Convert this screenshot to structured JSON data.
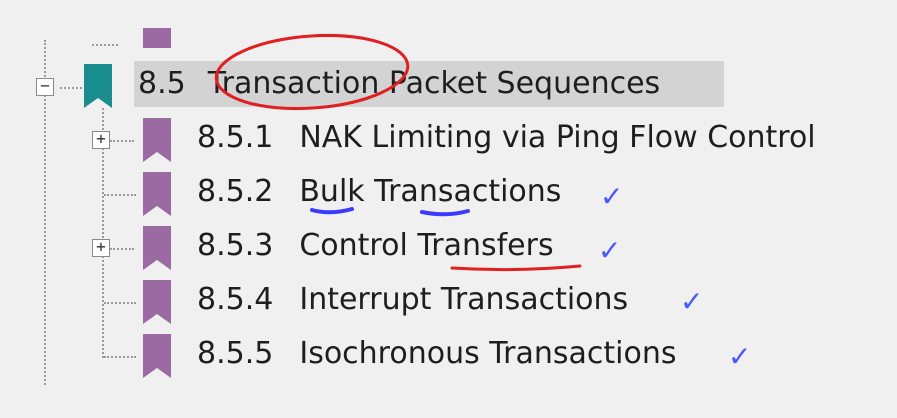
{
  "tree": {
    "selected": {
      "number": "8.5",
      "title": "Transaction Packet Sequences",
      "expander": "−"
    },
    "children": [
      {
        "number": "8.5.1",
        "title": "NAK Limiting via Ping Flow Control",
        "expander": "+",
        "checked": false
      },
      {
        "number": "8.5.2",
        "title": "Bulk Transactions",
        "expander": "",
        "checked": true
      },
      {
        "number": "8.5.3",
        "title": "Control Transfers",
        "expander": "+",
        "checked": true
      },
      {
        "number": "8.5.4",
        "title": "Interrupt Transactions",
        "expander": "",
        "checked": true
      },
      {
        "number": "8.5.5",
        "title": "Isochronous Transactions",
        "expander": "",
        "checked": true
      }
    ],
    "check_glyph": "✓"
  },
  "colors": {
    "bookmark_selected": "#1a8e8e",
    "bookmark_child": "#9b6aa2",
    "annotation_red": "#e02020",
    "annotation_blue": "#3a3aff"
  },
  "icons": {
    "selected": "bookmark-teal-icon",
    "child": "bookmark-purple-icon"
  }
}
